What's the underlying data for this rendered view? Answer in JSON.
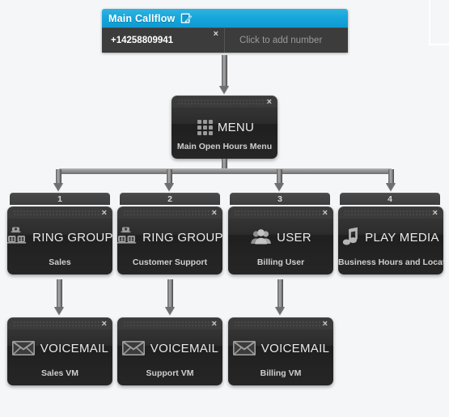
{
  "callflow": {
    "title": "Main Callflow",
    "edit_icon": "edit-pencil-icon",
    "numbers": [
      {
        "value": "+14258809941",
        "remove": "×",
        "state": "assigned"
      }
    ],
    "add_number_placeholder": "Click to add number"
  },
  "menu_node": {
    "type": "MENU",
    "name": "Main Open Hours Menu",
    "icon": "menu-grid-icon",
    "close": "×"
  },
  "branch_tabs": [
    "1",
    "2",
    "3",
    "4"
  ],
  "branch_nodes": [
    {
      "type": "RING GROUP",
      "name": "Sales",
      "icon": "ring-group-phones-icon",
      "close": "×"
    },
    {
      "type": "RING GROUP",
      "name": "Customer Support",
      "icon": "ring-group-phones-icon",
      "close": "×"
    },
    {
      "type": "USER",
      "name": "Billing User",
      "icon": "user-people-icon",
      "close": "×"
    },
    {
      "type": "PLAY MEDIA",
      "name": "Business Hours and Location",
      "icon": "music-note-icon",
      "close": "×"
    }
  ],
  "voicemail_nodes": [
    {
      "type": "VOICEMAIL",
      "name": "Sales VM",
      "icon": "envelope-icon",
      "close": "×"
    },
    {
      "type": "VOICEMAIL",
      "name": "Support VM",
      "icon": "envelope-icon",
      "close": "×"
    },
    {
      "type": "VOICEMAIL",
      "name": "Billing VM",
      "icon": "envelope-icon",
      "close": "×"
    }
  ],
  "colors": {
    "header_blue": "#16a5db",
    "node_dark": "#262626",
    "canvas_bg": "#f4f6f8",
    "connector_gray": "#8f8f8f",
    "node_label": "#e9e9e9"
  }
}
